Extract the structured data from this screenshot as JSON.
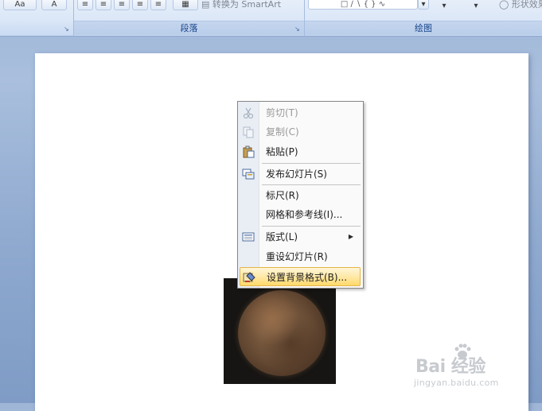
{
  "ribbon": {
    "partial_buttons": {
      "font_size_label": "Aa",
      "font_color_label": "A",
      "smartart_label": "转换为 SmartArt",
      "shape_effects_label": "形状效果"
    },
    "groups": [
      {
        "label": "段落"
      },
      {
        "label": "绘图"
      }
    ]
  },
  "context_menu": {
    "items": [
      {
        "label": "剪切(T)",
        "icon": "scissors-icon",
        "enabled": false
      },
      {
        "label": "复制(C)",
        "icon": "copy-icon",
        "enabled": false
      },
      {
        "label": "粘贴(P)",
        "icon": "paste-icon",
        "enabled": true
      },
      {
        "label": "发布幻灯片(S)",
        "icon": "publish-slides-icon",
        "enabled": true
      },
      {
        "label": "标尺(R)",
        "icon": "",
        "enabled": true
      },
      {
        "label": "网格和参考线(I)...",
        "icon": "",
        "enabled": true
      },
      {
        "label": "版式(L)",
        "icon": "layout-icon",
        "enabled": true,
        "submenu": true
      },
      {
        "label": "重设幻灯片(R)",
        "icon": "",
        "enabled": true
      },
      {
        "label": "设置背景格式(B)...",
        "icon": "format-background-icon",
        "enabled": true,
        "highlighted": true
      }
    ]
  },
  "watermark": {
    "logo_text": "Bai 经验",
    "url": "jingyan.baidu.com"
  },
  "colors": {
    "ribbon_label": "#15428b",
    "menu_highlight": "#ffd96a",
    "workspace_bg": "#9fb6d7"
  }
}
